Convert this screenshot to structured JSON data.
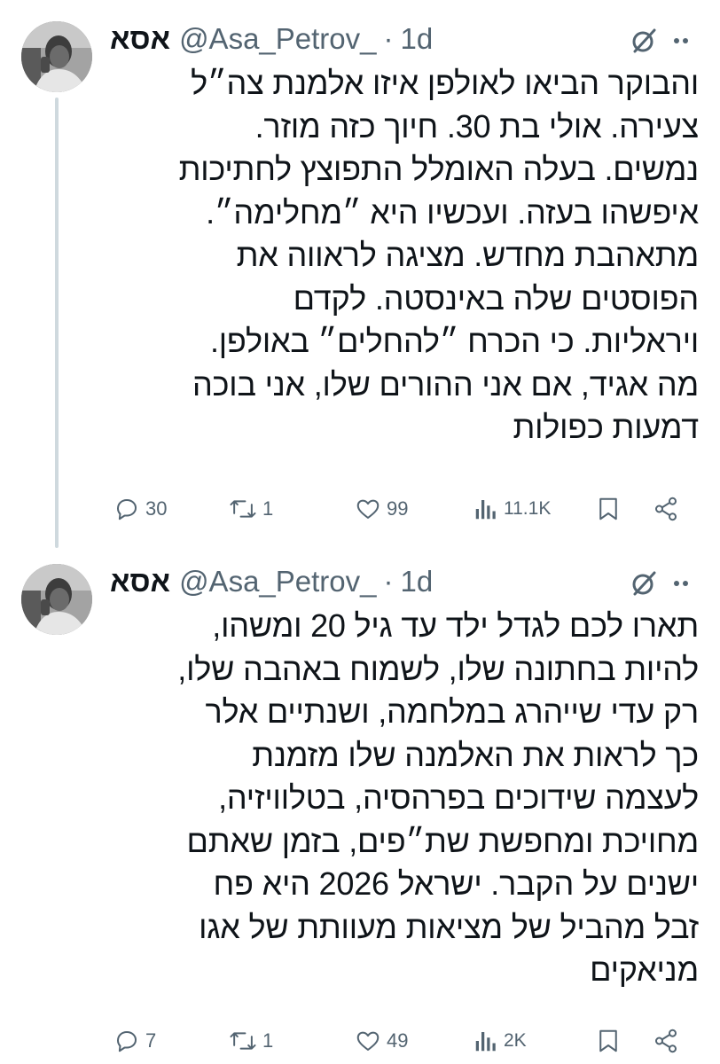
{
  "tweets": [
    {
      "display_name": "אסא",
      "handle": "@Asa_Petrov_",
      "separator": "·",
      "time": "1d",
      "lines": [
        "והבוקר הביאו לאולפן איזו אלמנת צה״ל",
        "צעירה. אולי בת 30. חיוך כזה מוזר.",
        "נמשים. בעלה האומלל התפוצץ לחתיכות",
        "איפשהו בעזה. ועכשיו היא ״מחלימה״.",
        "מתאהבת מחדש. מציגה לראווה את",
        "הפוסטים שלה באינסטה. לקדם",
        "ויראליות. כי הכרח ״להחלים״ באולפן.",
        "מה אגיד, אם אני ההורים שלו, אני בוכה",
        "דמעות כפולות"
      ],
      "replies": "30",
      "reposts": "1",
      "likes": "99",
      "views": "11.1K"
    },
    {
      "display_name": "אסא",
      "handle": "@Asa_Petrov_",
      "separator": "·",
      "time": "1d",
      "lines": [
        "תארו לכם לגדל ילד עד גיל 20 ומשהו,",
        "להיות בחתונה שלו, לשמוח באהבה שלו,",
        "רק עדי שייהרג במלחמה, ושנתיים אלר",
        "כך לראות את האלמנה שלו מזמנת",
        "לעצמה שידוכים בפרהסיה, בטלוויזיה,",
        "מחויכת ומחפשת שת״פים, בזמן שאתם",
        "ישנים על הקבר. ישראל 2026 היא פח",
        "זבל מהביל של מציאות מעוותת של אגו",
        "מניאקים"
      ],
      "replies": "7",
      "reposts": "1",
      "likes": "49",
      "views": "2K"
    }
  ],
  "icons": {
    "avatar": "user-avatar-photo",
    "grok": "grok-icon",
    "more": "more-options-icon",
    "reply": "reply-icon",
    "repost": "repost-icon",
    "like": "like-icon",
    "views": "views-icon",
    "bookmark": "bookmark-icon",
    "share": "share-icon"
  },
  "colors": {
    "text": "#0f1419",
    "secondary": "#536471",
    "thread_line": "#cfd9de",
    "background": "#ffffff"
  }
}
